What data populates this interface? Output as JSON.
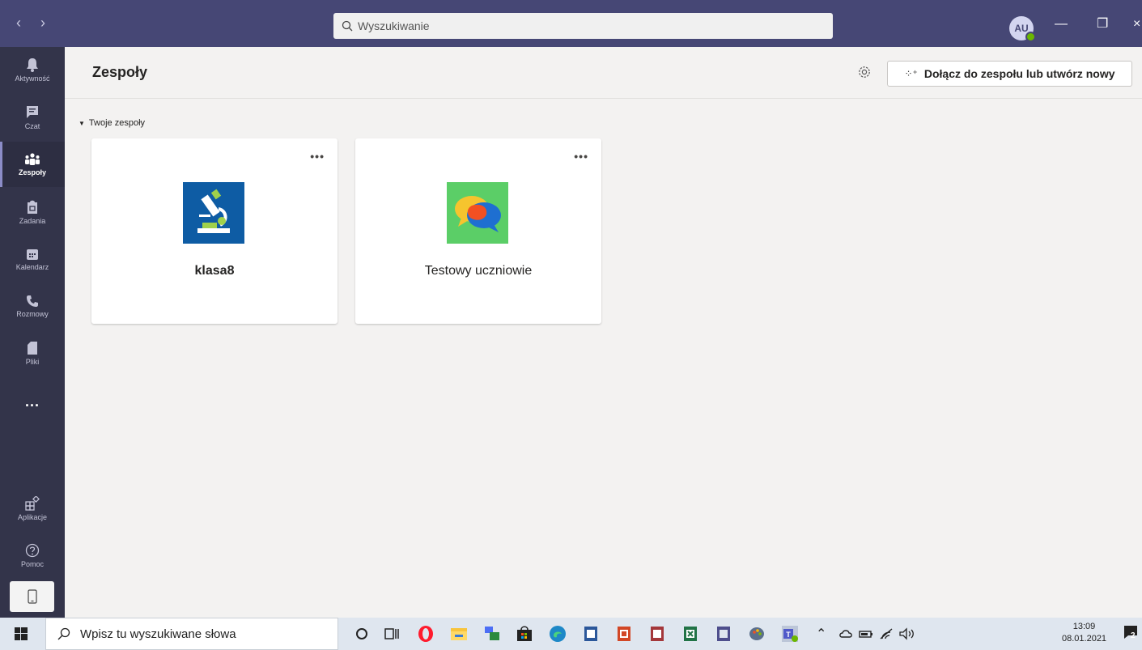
{
  "titlebar": {
    "search_placeholder": "Wyszukiwanie",
    "avatar_initials": "AU"
  },
  "rail": {
    "items": [
      {
        "label": "Aktywność",
        "icon": "bell-icon"
      },
      {
        "label": "Czat",
        "icon": "chat-icon"
      },
      {
        "label": "Zespoły",
        "icon": "teams-icon",
        "active": true
      },
      {
        "label": "Zadania",
        "icon": "assignments-icon"
      },
      {
        "label": "Kalendarz",
        "icon": "calendar-icon"
      },
      {
        "label": "Rozmowy",
        "icon": "phone-icon"
      },
      {
        "label": "Pliki",
        "icon": "files-icon"
      },
      {
        "label": "...",
        "icon": "more-icon"
      },
      {
        "label": "Aplikacje",
        "icon": "apps-icon"
      },
      {
        "label": "Pomoc",
        "icon": "help-icon"
      }
    ]
  },
  "header": {
    "title": "Zespoły",
    "join_button": "Dołącz do zespołu lub utwórz nowy"
  },
  "section": {
    "label": "Twoje zespoły"
  },
  "teams": [
    {
      "name": "klasa8",
      "more": "•••",
      "logo": "microscope-icon"
    },
    {
      "name": "Testowy uczniowie",
      "more": "•••",
      "logo": "chat-bubbles-icon"
    }
  ],
  "taskbar": {
    "search_placeholder": "Wpisz tu wyszukiwane słowa",
    "time": "13:09",
    "date": "08.01.2021",
    "notification_count": "2"
  },
  "colors": {
    "titlebar": "#464775",
    "rail": "#33344a",
    "accent": "#6264a7"
  }
}
